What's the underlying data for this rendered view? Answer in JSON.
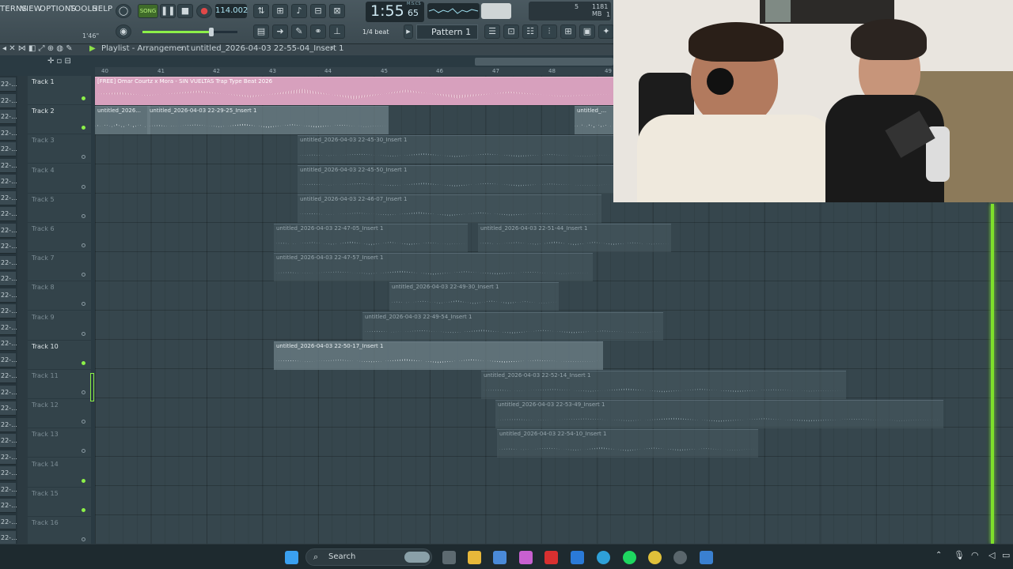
{
  "menu": [
    "TERNS",
    "VIEW",
    "OPTIONS",
    "TOOLS",
    "HELP"
  ],
  "transport": {
    "song_label": "SONG",
    "tempo": "114.002",
    "time": "1:55",
    "time_sub": "65",
    "time_unit": "M:S:CS",
    "cpu": "5",
    "memory": "1181 MB",
    "poly": "1",
    "time_left": "1'46\"",
    "snap": "1/4 beat",
    "pattern": "Pattern 1"
  },
  "playlist": {
    "breadcrumb": "Playlist - Arrangement",
    "file": "untitled_2026-04-03 22-55-04_Insert 1",
    "ruler": [
      "40",
      "41",
      "42",
      "43",
      "44",
      "45",
      "46",
      "47",
      "48",
      "49"
    ]
  },
  "channels": [
    "22-...",
    "22-...",
    "22-...",
    "22-...",
    "22-...",
    "22-...",
    "22-...",
    "22-...",
    "22-...",
    "22-...",
    "22-...",
    "22-...",
    "22-...",
    "22-...",
    "22-...",
    "22-...",
    "22-...",
    "22-...",
    "22-...",
    "22-...",
    "22-...",
    "22-...",
    "22-...",
    "22-...",
    "22-...",
    "22-...",
    "22-...",
    "22-...",
    "22-..."
  ],
  "tracks": [
    {
      "name": "Track 1",
      "active": true
    },
    {
      "name": "Track 2",
      "active": true
    },
    {
      "name": "Track 3",
      "active": false
    },
    {
      "name": "Track 4",
      "active": false
    },
    {
      "name": "Track 5",
      "active": false
    },
    {
      "name": "Track 6",
      "active": false
    },
    {
      "name": "Track 7",
      "active": false
    },
    {
      "name": "Track 8",
      "active": false
    },
    {
      "name": "Track 9",
      "active": false
    },
    {
      "name": "Track 10",
      "active": true
    },
    {
      "name": "Track 11",
      "active": false
    },
    {
      "name": "Track 12",
      "active": false
    },
    {
      "name": "Track 13",
      "active": false
    },
    {
      "name": "Track 14",
      "active": false
    },
    {
      "name": "Track 15",
      "active": false
    },
    {
      "name": "Track 16",
      "active": false
    }
  ],
  "clips": [
    {
      "label": "[FREE] Omar Courtz x Mora - SIN VUELTAS Trap Type Beat 2026"
    },
    {
      "label": "untitled_2026..."
    },
    {
      "label": "untitled_2026-04-03 22-29-25_Insert 1"
    },
    {
      "label": "untitled_..."
    },
    {
      "label": "untitled_2026-04-03 22-45-30_Insert 1"
    },
    {
      "label": "untitled_2026-04-03 22-45-50_Insert 1"
    },
    {
      "label": "untitled_2026-04-03 22-46-07_Insert 1"
    },
    {
      "label": "untitled_2026-04-03 22-47-05_Insert 1"
    },
    {
      "label": "untitled_2026-04-03 22-51-44_Insert 1"
    },
    {
      "label": "untitled_2026-04-03 22-47-57_Insert 1"
    },
    {
      "label": "untitled_2026-04-03 22-49-30_Insert 1"
    },
    {
      "label": "untitled_2026-04-03 22-49-54_Insert 1"
    },
    {
      "label": "untitled_2026-04-03 22-50-17_Insert 1"
    },
    {
      "label": "untitled_2026-04-03 22-52-14_Insert 1"
    },
    {
      "label": "untitled_2026-04-03 22-53-49_Insert 1"
    },
    {
      "label": "untitled_2026-04-03 22-54-10_Insert 1"
    }
  ],
  "taskbar": {
    "search": "Search"
  },
  "colors": {
    "accent_green": "#7ee02b",
    "clip_pink": "#d7a0bd",
    "bg": "#36464d"
  }
}
